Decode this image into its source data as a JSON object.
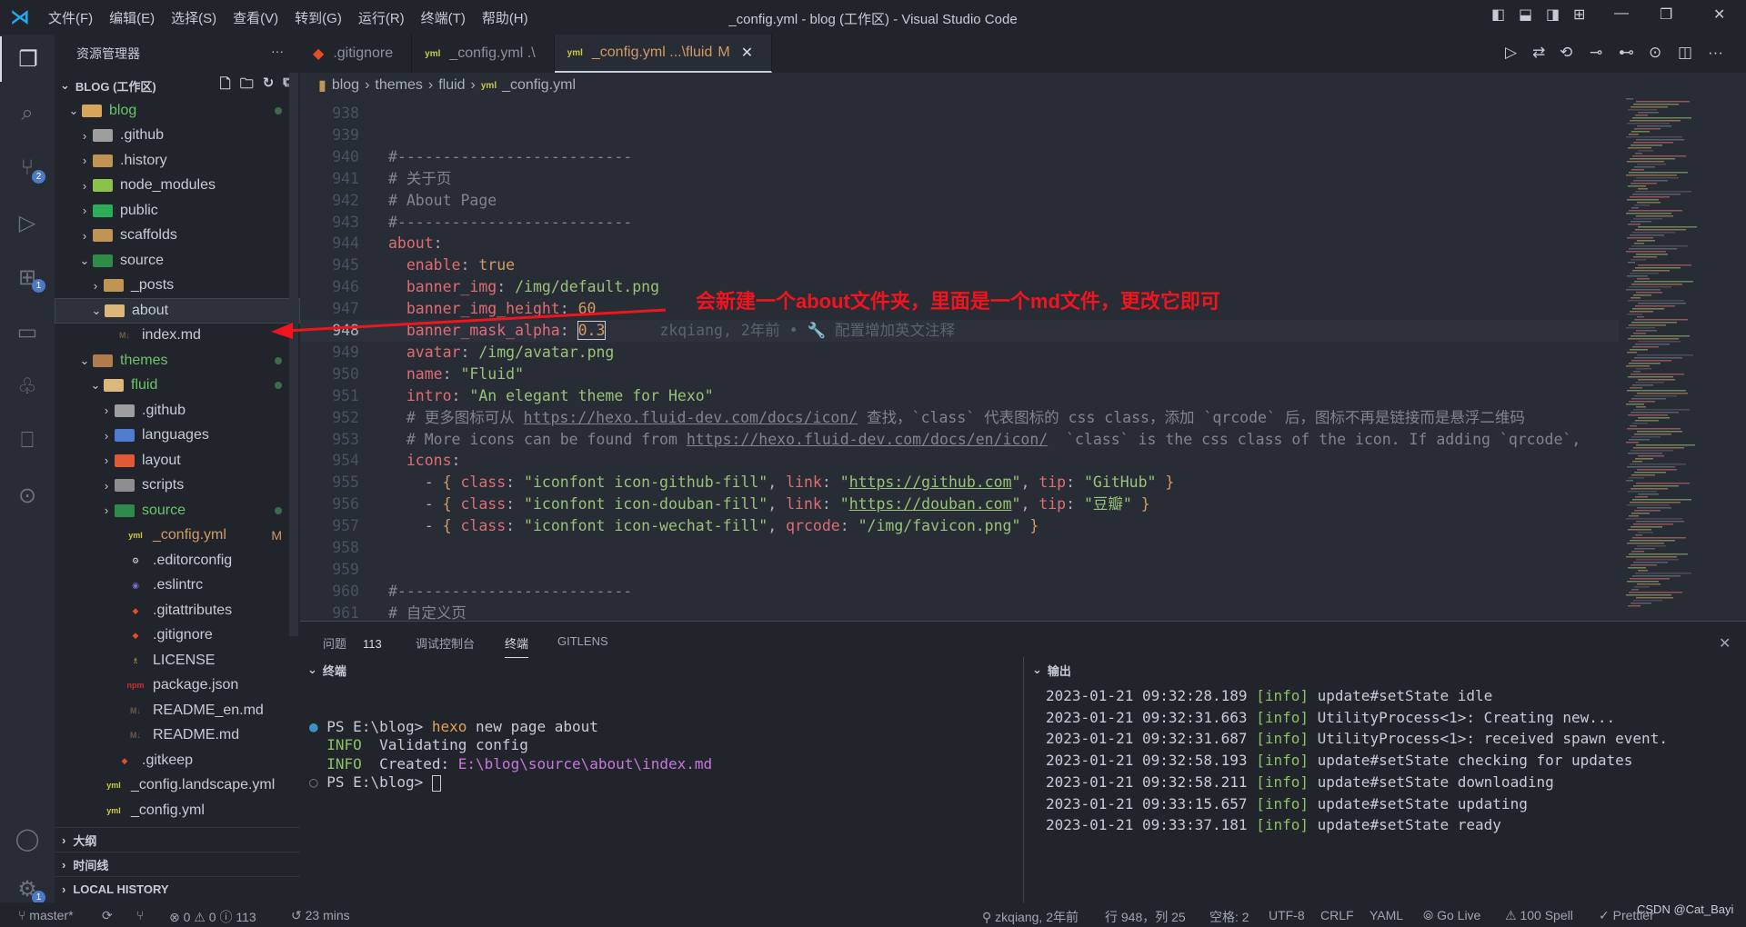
{
  "title_bar": {
    "menus": [
      "文件(F)",
      "编辑(E)",
      "选择(S)",
      "查看(V)",
      "转到(G)",
      "运行(R)",
      "终端(T)",
      "帮助(H)"
    ],
    "title": "_config.yml - blog (工作区) - Visual Studio Code"
  },
  "activity_bar": {
    "items": [
      {
        "name": "explorer-icon",
        "glyph": "❐"
      },
      {
        "name": "search-icon",
        "glyph": "⌕"
      },
      {
        "name": "source-control-icon",
        "glyph": "⑂",
        "badge": "2"
      },
      {
        "name": "run-debug-icon",
        "glyph": "▷"
      },
      {
        "name": "extensions-icon",
        "glyph": "⊞",
        "badge": "1"
      },
      {
        "name": "folder-icon",
        "glyph": "▭"
      },
      {
        "name": "tree-icon",
        "glyph": "♧"
      },
      {
        "name": "bookmark-icon",
        "glyph": "⎕"
      },
      {
        "name": "gitlens-icon",
        "glyph": "⊙"
      }
    ],
    "account_glyph": "◯",
    "settings_glyph": "⚙",
    "settings_badge": "1"
  },
  "sidebar": {
    "title": "资源管理器",
    "workspace": "BLOG (工作区)",
    "tree": [
      {
        "label": "blog",
        "level": 0,
        "open": true,
        "icon": "folder-open",
        "color": "#d8a657",
        "green": true,
        "dot": true
      },
      {
        "label": ".github",
        "level": 1,
        "open": false,
        "icon": "folder-github",
        "color": "#9e9e9e"
      },
      {
        "label": ".history",
        "level": 1,
        "open": false,
        "icon": "folder",
        "color": "#c09553"
      },
      {
        "label": "node_modules",
        "level": 1,
        "open": false,
        "icon": "folder-node",
        "color": "#8bc34a"
      },
      {
        "label": "public",
        "level": 1,
        "open": false,
        "icon": "folder-public",
        "color": "#2bad58"
      },
      {
        "label": "scaffolds",
        "level": 1,
        "open": false,
        "icon": "folder",
        "color": "#c09553"
      },
      {
        "label": "source",
        "level": 1,
        "open": true,
        "icon": "folder-src",
        "color": "#2e8b4a"
      },
      {
        "label": "_posts",
        "level": 2,
        "open": false,
        "icon": "folder",
        "color": "#c09553"
      },
      {
        "label": "about",
        "level": 2,
        "open": true,
        "icon": "folder-open",
        "color": "#dcb67a",
        "selected": true
      },
      {
        "label": "index.md",
        "level": 3,
        "file": true,
        "icon": "M↓",
        "color": "#6b5a44"
      },
      {
        "label": "themes",
        "level": 1,
        "open": true,
        "icon": "folder-theme",
        "color": "#b07c4f",
        "green": true,
        "dot": true
      },
      {
        "label": "fluid",
        "level": 2,
        "open": true,
        "icon": "folder-open",
        "color": "#dcb67a",
        "green": true,
        "dot": true
      },
      {
        "label": ".github",
        "level": 3,
        "open": false,
        "icon": "folder-github",
        "color": "#9e9e9e"
      },
      {
        "label": "languages",
        "level": 3,
        "open": false,
        "icon": "folder-lang",
        "color": "#4e7dcf"
      },
      {
        "label": "layout",
        "level": 3,
        "open": false,
        "icon": "folder-layout",
        "color": "#e05a3a"
      },
      {
        "label": "scripts",
        "level": 3,
        "open": false,
        "icon": "folder-scripts",
        "color": "#8e8e8e"
      },
      {
        "label": "source",
        "level": 3,
        "open": false,
        "icon": "folder-src",
        "color": "#2e8b4a",
        "green": true,
        "dot": true
      },
      {
        "label": "_config.yml",
        "level": 4,
        "file": true,
        "icon": "yml",
        "color": "#cbcb41",
        "mark": "M",
        "modified": true
      },
      {
        "label": ".editorconfig",
        "level": 4,
        "file": true,
        "icon": "⚙",
        "color": "#e0e0e0"
      },
      {
        "label": ".eslintrc",
        "level": 4,
        "file": true,
        "icon": "◉",
        "color": "#7c6fd8"
      },
      {
        "label": ".gitattributes",
        "level": 4,
        "file": true,
        "icon": "◆",
        "color": "#e44d26"
      },
      {
        "label": ".gitignore",
        "level": 4,
        "file": true,
        "icon": "◆",
        "color": "#e44d26"
      },
      {
        "label": "LICENSE",
        "level": 4,
        "file": true,
        "icon": "♗",
        "color": "#d8a03c"
      },
      {
        "label": "package.json",
        "level": 4,
        "file": true,
        "icon": "npm",
        "color": "#c93232"
      },
      {
        "label": "README_en.md",
        "level": 4,
        "file": true,
        "icon": "M↓",
        "color": "#6b5a44"
      },
      {
        "label": "README.md",
        "level": 4,
        "file": true,
        "icon": "M↓",
        "color": "#6b5a44"
      },
      {
        "label": ".gitkeep",
        "level": 3,
        "file": true,
        "icon": "◆",
        "color": "#e44d26"
      },
      {
        "label": "_config.landscape.yml",
        "level": 2,
        "file": true,
        "icon": "yml",
        "color": "#cbcb41"
      },
      {
        "label": "_config.yml",
        "level": 2,
        "file": true,
        "icon": "yml",
        "color": "#cbcb41"
      }
    ],
    "sections": [
      "大纲",
      "时间线",
      "LOCAL HISTORY"
    ]
  },
  "tabs": [
    {
      "label": ".gitignore",
      "icon": "◆",
      "icon_color": "#e44d26"
    },
    {
      "label": "_config.yml .\\",
      "icon": "yml",
      "icon_color": "#cbcb41"
    },
    {
      "label": "_config.yml ...\\fluid",
      "icon": "yml",
      "icon_color": "#cbcb41",
      "active": true,
      "modified": "M"
    }
  ],
  "breadcrumb": [
    "blog",
    "themes",
    "fluid",
    "_config.yml"
  ],
  "editor": {
    "lines": [
      {
        "n": "938",
        "t": []
      },
      {
        "n": "939",
        "t": []
      },
      {
        "n": "940",
        "t": [
          [
            "#--------------------------",
            "t-c"
          ]
        ]
      },
      {
        "n": "941",
        "t": [
          [
            "# 关于页",
            "t-c"
          ]
        ]
      },
      {
        "n": "942",
        "t": [
          [
            "# About Page",
            "t-c"
          ]
        ]
      },
      {
        "n": "943",
        "t": [
          [
            "#--------------------------",
            "t-c"
          ]
        ]
      },
      {
        "n": "944",
        "t": [
          [
            "about",
            "t-k"
          ],
          [
            ":",
            "t-p"
          ]
        ]
      },
      {
        "n": "945",
        "t": [
          [
            "  enable",
            "t-k"
          ],
          [
            ": ",
            "t-p"
          ],
          [
            "true",
            "t-n"
          ]
        ]
      },
      {
        "n": "946",
        "t": [
          [
            "  banner_img",
            "t-k"
          ],
          [
            ": ",
            "t-p"
          ],
          [
            "/img/default.png",
            "t-s"
          ]
        ]
      },
      {
        "n": "947",
        "t": [
          [
            "  banner_img_height",
            "t-k"
          ],
          [
            ": ",
            "t-p"
          ],
          [
            "60",
            "t-n"
          ]
        ]
      },
      {
        "n": "948",
        "cur": true,
        "t": [
          [
            "  banner_mask_alpha",
            "t-k"
          ],
          [
            ": ",
            "t-p"
          ],
          [
            "0.3",
            "t-n sel03"
          ]
        ],
        "blame": "zkqiang, 2年前 • 🔧 配置增加英文注释"
      },
      {
        "n": "949",
        "t": [
          [
            "  avatar",
            "t-k"
          ],
          [
            ": ",
            "t-p"
          ],
          [
            "/img/avatar.png",
            "t-s"
          ]
        ]
      },
      {
        "n": "950",
        "t": [
          [
            "  name",
            "t-k"
          ],
          [
            ": ",
            "t-p"
          ],
          [
            "\"Fluid\"",
            "t-s"
          ]
        ]
      },
      {
        "n": "951",
        "t": [
          [
            "  intro",
            "t-k"
          ],
          [
            ": ",
            "t-p"
          ],
          [
            "\"An elegant theme for Hexo\"",
            "t-s"
          ]
        ]
      },
      {
        "n": "952",
        "t": [
          [
            "  # 更多图标可从 ",
            "t-c"
          ],
          [
            "https://hexo.fluid-dev.com/docs/icon/",
            "t-cu"
          ],
          [
            " 查找，`class` 代表图标的 css class，添加 `qrcode` 后，图标不再是链接而是悬浮二维码",
            "t-c"
          ]
        ]
      },
      {
        "n": "953",
        "t": [
          [
            "  # More icons can be found from ",
            "t-c"
          ],
          [
            "https://hexo.fluid-dev.com/docs/en/icon/",
            "t-cu"
          ],
          [
            "  `class` is the css class of the icon. If adding `qrcode`,",
            "t-c"
          ]
        ]
      },
      {
        "n": "954",
        "t": [
          [
            "  icons",
            "t-k"
          ],
          [
            ":",
            "t-p"
          ]
        ]
      },
      {
        "n": "955",
        "t": [
          [
            "    - ",
            "t-p"
          ],
          [
            "{ ",
            "t-b"
          ],
          [
            "class",
            "t-k"
          ],
          [
            ": ",
            "t-p"
          ],
          [
            "\"iconfont icon-github-fill\"",
            "t-s"
          ],
          [
            ", ",
            "t-p"
          ],
          [
            "link",
            "t-k"
          ],
          [
            ": ",
            "t-p"
          ],
          [
            "\"",
            "t-s"
          ],
          [
            "https://github.com",
            "t-u"
          ],
          [
            "\"",
            "t-s"
          ],
          [
            ", ",
            "t-p"
          ],
          [
            "tip",
            "t-k"
          ],
          [
            ": ",
            "t-p"
          ],
          [
            "\"GitHub\"",
            "t-s"
          ],
          [
            " }",
            "t-b"
          ]
        ]
      },
      {
        "n": "956",
        "t": [
          [
            "    - ",
            "t-p"
          ],
          [
            "{ ",
            "t-b"
          ],
          [
            "class",
            "t-k"
          ],
          [
            ": ",
            "t-p"
          ],
          [
            "\"iconfont icon-douban-fill\"",
            "t-s"
          ],
          [
            ", ",
            "t-p"
          ],
          [
            "link",
            "t-k"
          ],
          [
            ": ",
            "t-p"
          ],
          [
            "\"",
            "t-s"
          ],
          [
            "https://douban.com",
            "t-u"
          ],
          [
            "\"",
            "t-s"
          ],
          [
            ", ",
            "t-p"
          ],
          [
            "tip",
            "t-k"
          ],
          [
            ": ",
            "t-p"
          ],
          [
            "\"豆瓣\"",
            "t-s"
          ],
          [
            " }",
            "t-b"
          ]
        ]
      },
      {
        "n": "957",
        "t": [
          [
            "    - ",
            "t-p"
          ],
          [
            "{ ",
            "t-b"
          ],
          [
            "class",
            "t-k"
          ],
          [
            ": ",
            "t-p"
          ],
          [
            "\"iconfont icon-wechat-fill\"",
            "t-s"
          ],
          [
            ", ",
            "t-p"
          ],
          [
            "qrcode",
            "t-k"
          ],
          [
            ": ",
            "t-p"
          ],
          [
            "\"/img/favicon.png\"",
            "t-s"
          ],
          [
            " }",
            "t-b"
          ]
        ]
      },
      {
        "n": "958",
        "t": []
      },
      {
        "n": "959",
        "t": []
      },
      {
        "n": "960",
        "t": [
          [
            "#--------------------------",
            "t-c"
          ]
        ]
      },
      {
        "n": "961",
        "t": [
          [
            "# 自定义页",
            "t-c"
          ]
        ]
      }
    ]
  },
  "annotation": {
    "text": "会新建一个about文件夹，里面是一个md文件，更改它即可",
    "color": "#f0141e"
  },
  "panel": {
    "tabs": [
      {
        "label": "问题",
        "count": "113"
      },
      {
        "label": "调试控制台"
      },
      {
        "label": "终端",
        "active": true
      },
      {
        "label": "GITLENS"
      }
    ],
    "terminal": {
      "title": "终端",
      "prompt": "PS E:\\blog> ",
      "cmd": "hexo",
      "args": " new page about",
      "info": "INFO",
      "l2": "  Validating config",
      "l3a": "  Created: ",
      "l3b": "E:\\blog\\source\\about\\index.md",
      "prompt2": "PS E:\\blog> "
    },
    "output": {
      "title": "输出",
      "lines": [
        {
          "ts": "2023-01-21 09:32:28.189",
          "lvl": "[info]",
          "msg": "update#setState idle"
        },
        {
          "ts": "2023-01-21 09:32:31.663",
          "lvl": "[info]",
          "msg": "UtilityProcess<1>: Creating new..."
        },
        {
          "ts": "2023-01-21 09:32:31.687",
          "lvl": "[info]",
          "msg": "UtilityProcess<1>: received spawn event."
        },
        {
          "ts": "2023-01-21 09:32:58.193",
          "lvl": "[info]",
          "msg": "update#setState checking for updates"
        },
        {
          "ts": "2023-01-21 09:32:58.211",
          "lvl": "[info]",
          "msg": "update#setState downloading"
        },
        {
          "ts": "2023-01-21 09:33:15.657",
          "lvl": "[info]",
          "msg": "update#setState updating"
        },
        {
          "ts": "2023-01-21 09:33:37.181",
          "lvl": "[info]",
          "msg": "update#setState ready"
        }
      ]
    }
  },
  "status_bar": {
    "branch": "master*",
    "errors": "0",
    "warnings": "0",
    "infos": "113",
    "time": "23 mins",
    "blame": "zkqiang, 2年前",
    "position": "行 948，列 25",
    "spaces": "空格: 2",
    "encoding": "UTF-8",
    "eol": "CRLF",
    "language": "YAML",
    "golive": "Go Live",
    "spell": "100 Spell",
    "prettier": "Prettier",
    "watermark": "CSDN @Cat_Bayi"
  }
}
